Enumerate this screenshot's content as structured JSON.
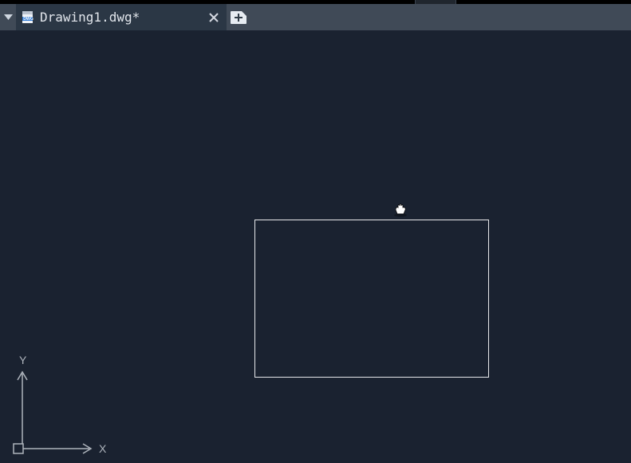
{
  "tabbar": {
    "active_tab": {
      "filename": "Drawing1.dwg*",
      "icon": "dwg-file-icon",
      "modified": true
    },
    "dropdown_icon": "chevron-down-icon",
    "close_icon": "close-icon",
    "new_tab_icon": "new-tab-plus-icon"
  },
  "canvas": {
    "cursor": "pan-hand-cursor",
    "shapes": [
      {
        "type": "rectangle"
      }
    ],
    "ucs": {
      "x_label": "X",
      "y_label": "Y"
    }
  },
  "colors": {
    "canvas_bg": "#1a2230",
    "tabbar_bg": "#404a57",
    "active_tab_bg": "#2b3745",
    "stroke": "#e8e9eb",
    "axis": "#aeb4bc"
  }
}
